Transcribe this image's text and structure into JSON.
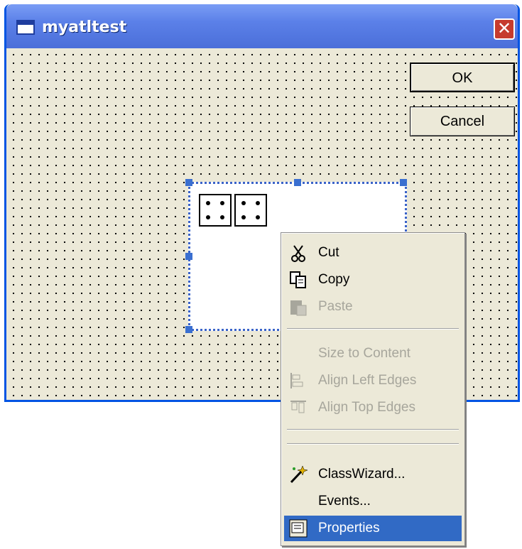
{
  "window": {
    "title": "myatltest"
  },
  "buttons": {
    "ok": "OK",
    "cancel": "Cancel"
  },
  "context_menu": {
    "items": [
      {
        "label": "Cut",
        "enabled": true,
        "icon": "scissors-icon"
      },
      {
        "label": "Copy",
        "enabled": true,
        "icon": "copy-icon"
      },
      {
        "label": "Paste",
        "enabled": false,
        "icon": "paste-icon"
      },
      {
        "label": "Size to Content",
        "enabled": false
      },
      {
        "label": "Align Left Edges",
        "enabled": false,
        "icon": "align-left-icon"
      },
      {
        "label": "Align Top Edges",
        "enabled": false,
        "icon": "align-top-icon"
      },
      {
        "label": "ClassWizard...",
        "enabled": true,
        "icon": "wizard-icon"
      },
      {
        "label": "Events...",
        "enabled": true
      },
      {
        "label": "Properties",
        "enabled": true,
        "highlighted": true,
        "icon": "properties-icon"
      }
    ]
  },
  "colors": {
    "titlebar": "#4b6fd9",
    "highlight": "#316ac5",
    "close": "#c63b2e"
  }
}
